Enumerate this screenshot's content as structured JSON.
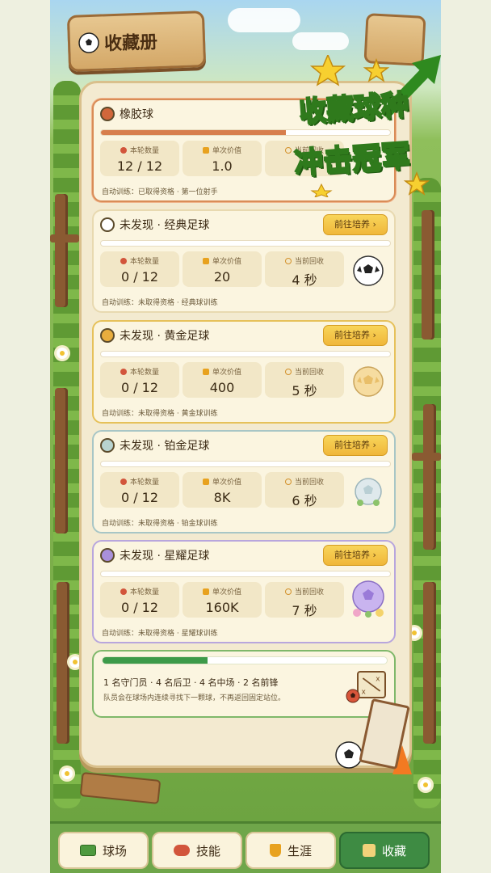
{
  "header": {
    "title": "收藏册"
  },
  "promo": {
    "line1": "收藏球种",
    "line2": "冲击冠军"
  },
  "stat_labels": {
    "count": "本轮数量",
    "value": "单次价值",
    "recovery": "当前回收"
  },
  "goto_label": "前往培养 ›",
  "cards": [
    {
      "name": "橡胶球",
      "count": "12 / 12",
      "value": "1.0",
      "recovery": "",
      "auto": "自动训练：已取得资格 · 第一位射手",
      "progress": 0.64,
      "dot_color": "#d1673b"
    },
    {
      "name": "未发现 · 经典足球",
      "count": "0 / 12",
      "value": "20",
      "recovery": "4 秒",
      "auto": "自动训练：未取得资格 · 经典球训练",
      "progress": 0,
      "dot_color": "#ffffff"
    },
    {
      "name": "未发现 · 黄金足球",
      "count": "0 / 12",
      "value": "400",
      "recovery": "5 秒",
      "auto": "自动训练：未取得资格 · 黄金球训练",
      "progress": 0,
      "dot_color": "#e8ad3e"
    },
    {
      "name": "未发现 · 铂金足球",
      "count": "0 / 12",
      "value": "8K",
      "recovery": "6 秒",
      "auto": "自动训练：未取得资格 · 铂金球训练",
      "progress": 0,
      "dot_color": "#b8d3d0"
    },
    {
      "name": "未发现 · 星耀足球",
      "count": "0 / 12",
      "value": "160K",
      "recovery": "7 秒",
      "auto": "自动训练：未取得资格 · 星耀球训练",
      "progress": 0,
      "dot_color": "#a990db"
    }
  ],
  "formation": {
    "line1": "1 名守门员 · 4 名后卫 · 4 名中场 · 2 名前锋",
    "line2": "队员会在球场内连续寻找下一颗球，不再返回固定站位。",
    "progress": 0.37
  },
  "tabs": [
    {
      "label": "球场",
      "icon": "pitch-icon",
      "active": false
    },
    {
      "label": "技能",
      "icon": "skill-icon",
      "active": false
    },
    {
      "label": "生涯",
      "icon": "trophy-icon",
      "active": false
    },
    {
      "label": "收藏",
      "icon": "album-icon",
      "active": true
    }
  ],
  "colors": {
    "accent_green": "#3e8b43",
    "goto_yellow": "#f0b73a",
    "progress_orange": "#d77e4c",
    "formation_green": "#3d9a49"
  }
}
